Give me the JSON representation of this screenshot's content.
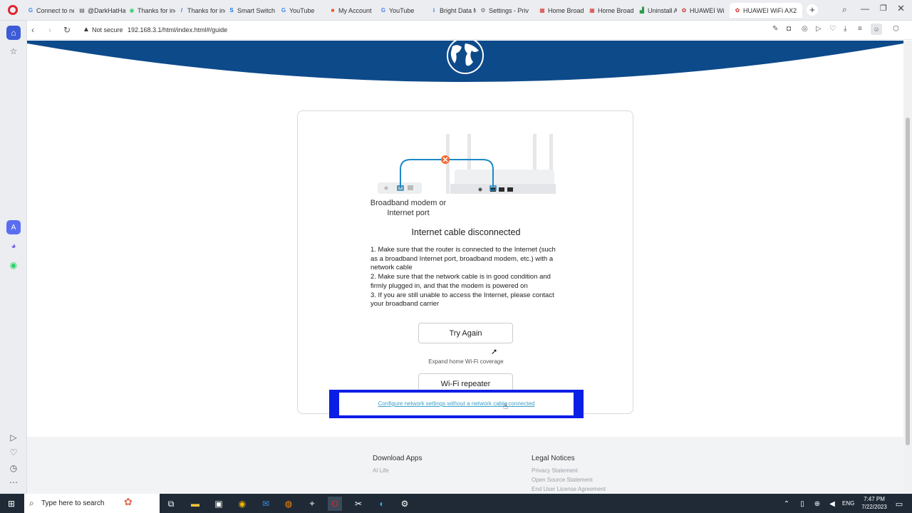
{
  "browser": {
    "tabs": [
      {
        "label": "Connect to ne",
        "icon": "google-icon",
        "color": "#4285f4",
        "glyph": "G"
      },
      {
        "label": "@DarkHatHac",
        "icon": "doc-icon",
        "color": "#555555",
        "glyph": "▤"
      },
      {
        "label": "Thanks for inc",
        "icon": "whatsapp-icon",
        "color": "#25d366",
        "glyph": "◉"
      },
      {
        "label": "Thanks for inc",
        "icon": "slash-icon",
        "color": "#3b6ed6",
        "glyph": "/"
      },
      {
        "label": "Smart Switch",
        "icon": "samsung-icon",
        "color": "#1a73e8",
        "glyph": "S"
      },
      {
        "label": "YouTube",
        "icon": "google-icon",
        "color": "#4285f4",
        "glyph": "G"
      },
      {
        "label": "My Account",
        "icon": "microsoft-icon",
        "color": "#f25022",
        "glyph": "■"
      },
      {
        "label": "YouTube",
        "icon": "google-icon",
        "color": "#4285f4",
        "glyph": "G"
      },
      {
        "label": "Bright Data M",
        "icon": "info-icon",
        "color": "#3a6fd8",
        "glyph": "i"
      },
      {
        "label": "Settings - Priv",
        "icon": "gear-icon",
        "color": "#666666",
        "glyph": "⚙"
      },
      {
        "label": "Home Broadb",
        "icon": "huawei-grid-icon",
        "color": "#d32f2f",
        "glyph": "▦"
      },
      {
        "label": "Home Broadb",
        "icon": "huawei-grid-icon",
        "color": "#d32f2f",
        "glyph": "▦"
      },
      {
        "label": "Uninstall Apo",
        "icon": "chart-icon",
        "color": "#2e9b4e",
        "glyph": "▟"
      },
      {
        "label": "HUAWEI WiFi",
        "icon": "huawei-icon",
        "color": "#d32f2f",
        "glyph": "✿"
      },
      {
        "label": "HUAWEI WiFi AX2",
        "icon": "huawei-icon",
        "color": "#d32f2f",
        "glyph": "✿",
        "active": true
      }
    ],
    "url_security": "Not secure",
    "url": "192.168.3.1/html/index.html#/guide"
  },
  "card": {
    "modem_label": "Broadband modem or Internet port",
    "status_title": "Internet cable disconnected",
    "instructions": [
      "1. Make sure that the router is connected to the Internet (such as a broadband Internet port, broadband modem, etc.) with a network cable",
      "2. Make sure that the network cable is in good condition and firmly plugged in, and that the modem is powered on",
      "3. If you are still unable to access the Internet, please contact your broadband carrier"
    ],
    "try_again": "Try Again",
    "expand_label": "Expand home Wi-Fi coverage",
    "repeater": "Wi-Fi repeater",
    "configure_link": "Configure network settings without a network cable connected"
  },
  "footer": {
    "download_title": "Download Apps",
    "download_links": [
      "AI Life"
    ],
    "legal_title": "Legal Notices",
    "legal_links": [
      "Privacy Statement",
      "Open Source Statement",
      "End User License Agreement"
    ]
  },
  "taskbar": {
    "search_placeholder": "Type here to search",
    "lang": "ENG",
    "time": "7:47 PM",
    "date": "7/22/2023"
  },
  "colors": {
    "header_blue": "#0d4a8a",
    "link_teal": "#3aa0c8",
    "highlight_blue": "#0a1ee6",
    "cable_blue": "#1e88c8",
    "error_orange": "#f06a35"
  }
}
